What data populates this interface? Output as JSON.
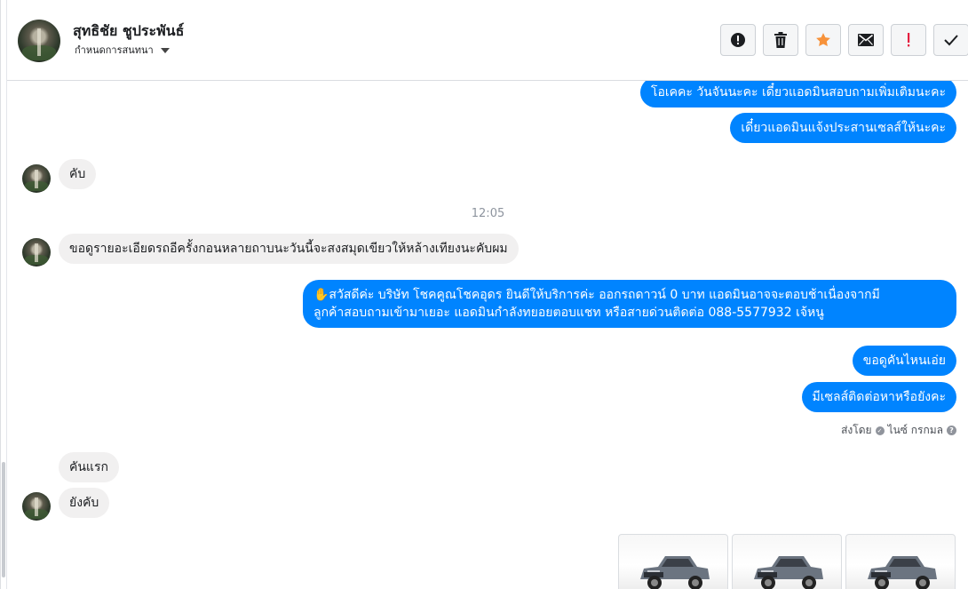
{
  "header": {
    "contact_name": "สุทธิชัย ชูประพันธ์",
    "subtitle": "กำหนดการสนทนา",
    "buttons": [
      {
        "icon": "alert-circle-icon",
        "label": "!"
      },
      {
        "icon": "trash-icon",
        "label": ""
      },
      {
        "icon": "star-icon",
        "label": "★"
      },
      {
        "icon": "mail-icon",
        "label": ""
      },
      {
        "icon": "exclamation-icon",
        "label": "!"
      },
      {
        "icon": "checkmark-icon",
        "label": "✓"
      }
    ]
  },
  "colors": {
    "outgoing_bubble": "#0084ff",
    "incoming_bubble": "#f1f0f0",
    "star": "#f7923a",
    "important": "#e41e3f"
  },
  "messages": {
    "out_1": "โอเคคะ วันจันนะคะ  เดี๋ยวแอดมินสอบถามเพิ่มเติมนะคะ",
    "out_2": "เดี๋ยวแอดมินแจ้งประสานเซลส์ให้นะคะ",
    "in_1": "คับ",
    "timestamp": "12:05",
    "in_2": "ขอดูรายอะเอียดรถอีครั้งกอนหลายถาบนะวันนี้จะสงสมุดเขียวให้หล้างเทียงนะคับผม",
    "out_3_line1": "✋สวัสดีค่ะ บริษัท โชคคูณโชคอุดร ยินดีให้บริการค่ะ ออกรถดาวน์ 0 บาท แอดมินอาจจะตอบช้าเนื่องจากมี",
    "out_3_line2": "ลูกค้าสอบถามเข้ามาเยอะ แอดมินกำลังทยอยตอบแชท หรือสายด่วนติดต่อ 088-5577932 เจ้หนู",
    "out_4": "ขอดูคันไหนเอ่ย",
    "out_5": "มีเซลส์ติดต่อหาหรือยังคะ",
    "sent_by_label": "ส่งโดย",
    "sent_by_name": "ไนซ์ กรกมล",
    "in_3": "คันแรก",
    "in_4": "ยังคับ"
  },
  "attachments": [
    {
      "type": "image",
      "subject": "grey pickup truck"
    },
    {
      "type": "image",
      "subject": "grey pickup truck"
    },
    {
      "type": "image",
      "subject": "grey pickup truck"
    }
  ]
}
